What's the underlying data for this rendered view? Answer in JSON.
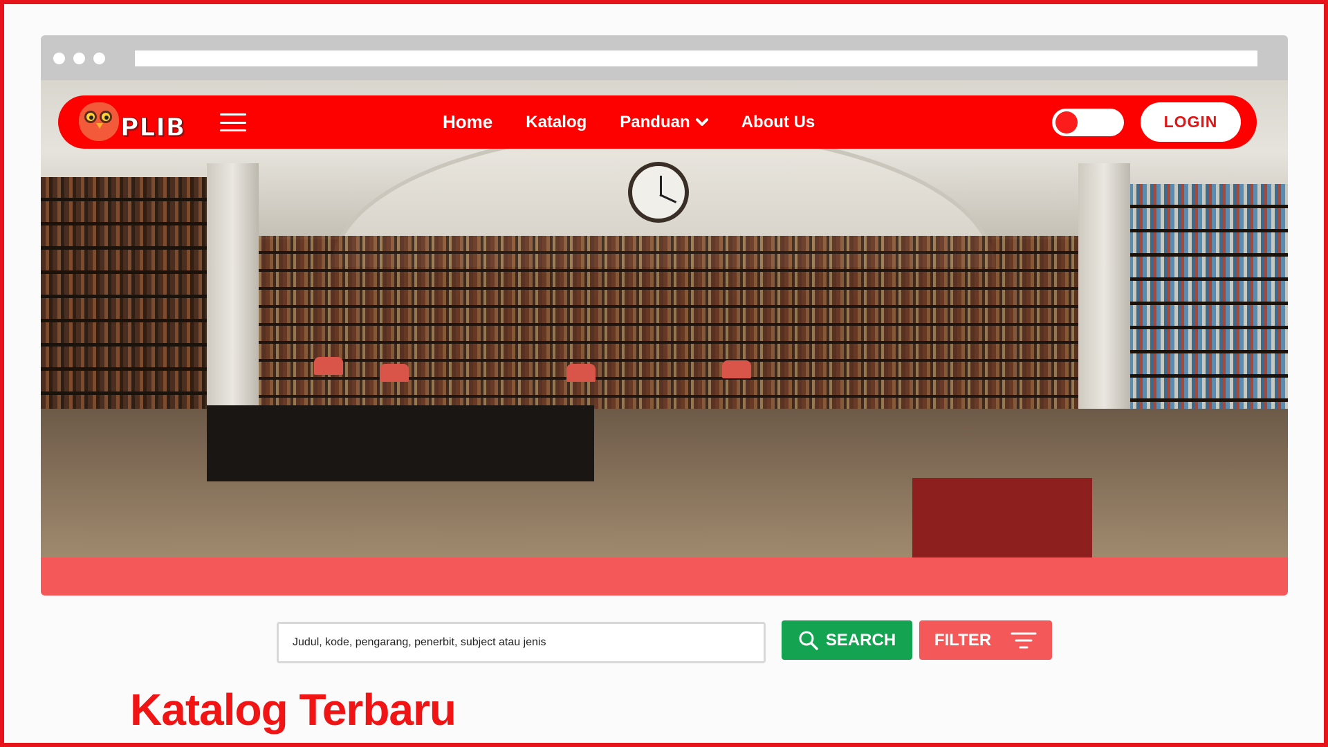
{
  "brand": {
    "logo_text": "PLIB"
  },
  "nav": {
    "items": [
      {
        "label": "Home",
        "active": true
      },
      {
        "label": "Katalog"
      },
      {
        "label": "Panduan",
        "has_dropdown": true
      },
      {
        "label": "About Us"
      }
    ],
    "login_label": "LOGIN",
    "theme_toggle": "off"
  },
  "search": {
    "placeholder": "Judul, kode, pengarang, penerbit, subject atau jenis",
    "button_label": "SEARCH",
    "filter_label": "FILTER"
  },
  "section": {
    "title": "Katalog Terbaru"
  },
  "colors": {
    "primary": "#fd0000",
    "accent_soft": "#f55858",
    "search_green": "#14a451",
    "title_red": "#f01414"
  },
  "icons": [
    "owl-logo-icon",
    "hamburger-icon",
    "chevron-down-icon",
    "search-icon",
    "filter-icon"
  ]
}
